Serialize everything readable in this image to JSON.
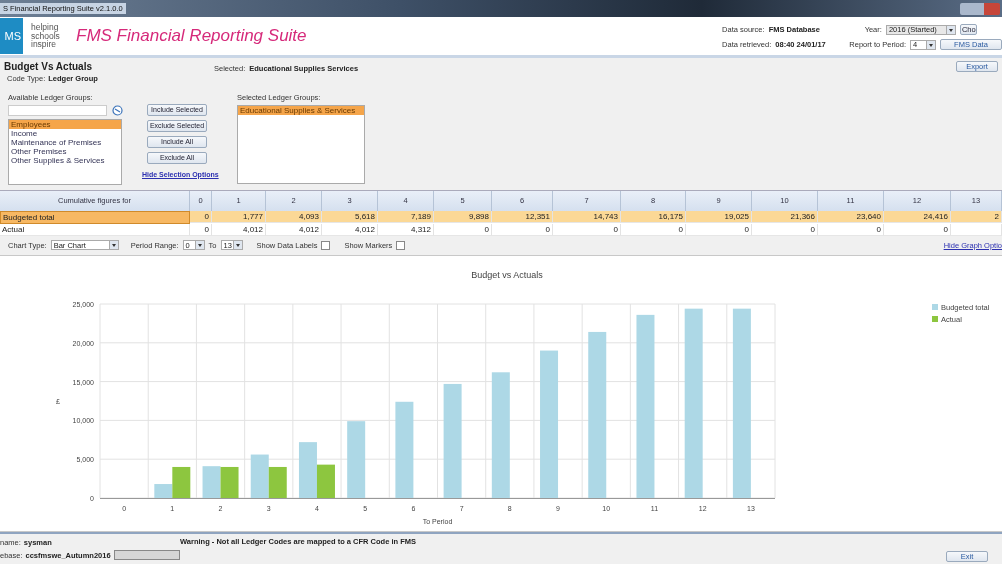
{
  "window": {
    "title": "S Financial Reporting Suite v2.1.0.0"
  },
  "header": {
    "logo": "MS",
    "tagline": [
      "helping",
      "schools",
      "inspire"
    ],
    "app_title": "FMS Financial Reporting Suite",
    "data_source_label": "Data source:",
    "data_source": "FMS Database",
    "year_label": "Year:",
    "year": "2016 (Started)",
    "year_button": "Cho",
    "retrieved_label": "Data retrieved:",
    "retrieved": "08:40 24/01/17",
    "period_label": "Report to Period:",
    "period": "4",
    "fms_button": "FMS Data"
  },
  "report": {
    "title": "Budget Vs Actuals",
    "code_type_label": "Code Type:",
    "code_type": "Ledger Group",
    "selected_label": "Selected:",
    "selected": "Educational Supplies  Services",
    "export_button": "Export"
  },
  "selection": {
    "available_label": "Available Ledger Groups:",
    "available": [
      {
        "label": "Employees",
        "selected": true
      },
      {
        "label": "Income",
        "selected": false
      },
      {
        "label": "Maintenance of Premises",
        "selected": false
      },
      {
        "label": "Other Premises",
        "selected": false
      },
      {
        "label": "Other Supplies & Services",
        "selected": false
      }
    ],
    "buttons": [
      "Include Selected",
      "Exclude Selected",
      "Include All",
      "Exclude All"
    ],
    "hide_link": "Hide Selection Options",
    "selected_label": "Selected Ledger Groups:",
    "selected_items": [
      {
        "label": "Educational Supplies & Services",
        "selected": true
      }
    ]
  },
  "table": {
    "corner": "Cumulative figures for",
    "columns": [
      "0",
      "1",
      "2",
      "3",
      "4",
      "5",
      "6",
      "7",
      "8",
      "9",
      "10",
      "11",
      "12",
      "13"
    ],
    "rows": [
      {
        "label": "Budgeted total",
        "selected": true,
        "values": [
          "0",
          "1,777",
          "4,093",
          "5,618",
          "7,189",
          "9,898",
          "12,351",
          "14,743",
          "16,175",
          "19,025",
          "21,366",
          "23,640",
          "24,416",
          "2"
        ]
      },
      {
        "label": "Actual",
        "selected": false,
        "values": [
          "0",
          "4,012",
          "4,012",
          "4,012",
          "4,312",
          "0",
          "0",
          "0",
          "0",
          "0",
          "0",
          "0",
          "0"
        ]
      }
    ]
  },
  "chart_options": {
    "chart_type_label": "Chart Type:",
    "chart_type": "Bar Chart",
    "range_label": "Period Range:",
    "range_from": "0",
    "to_label": "To",
    "range_to": "13",
    "checkboxes": [
      {
        "label": "Show Data Labels",
        "checked": false
      },
      {
        "label": "Show Markers",
        "checked": false
      }
    ],
    "hide_link": "Hide Graph Optio"
  },
  "chart": {
    "chart_data": {
      "type": "bar",
      "title": "Budget vs Actuals",
      "xlabel": "To Period",
      "ylabel": "£",
      "grid": true,
      "legend": true,
      "categories": [
        "0",
        "1",
        "2",
        "3",
        "4",
        "5",
        "6",
        "7",
        "8",
        "9",
        "10",
        "11",
        "12",
        "13"
      ],
      "ylim": [
        0,
        25000
      ],
      "yticks": [
        {
          "value": 0,
          "label": "0"
        },
        {
          "value": 5000,
          "label": "5,000"
        },
        {
          "value": 10000,
          "label": "10,000"
        },
        {
          "value": 15000,
          "label": "15,000"
        },
        {
          "value": 20000,
          "label": "20,000"
        },
        {
          "value": 25000,
          "label": "25,000"
        }
      ],
      "series": [
        {
          "name": "Budgeted total",
          "color": "#add8e6",
          "values": [
            0,
            1800,
            4100,
            5600,
            7200,
            9900,
            12400,
            14700,
            16200,
            19000,
            21400,
            23600,
            24400,
            24400
          ]
        },
        {
          "name": "Actual",
          "color": "#8dc63f",
          "values": [
            0,
            4000,
            4000,
            4000,
            4300,
            0,
            0,
            0,
            0,
            0,
            0,
            0,
            0,
            0
          ]
        }
      ]
    }
  },
  "footer": {
    "user_label": "name:",
    "user": "sysman",
    "db_label": "ebase:",
    "db": "ccsfmswe_Autumn2016",
    "warning": "Warning - Not all Ledger Codes are mapped to a CFR Code in FMS",
    "exit_button": "Exit"
  }
}
